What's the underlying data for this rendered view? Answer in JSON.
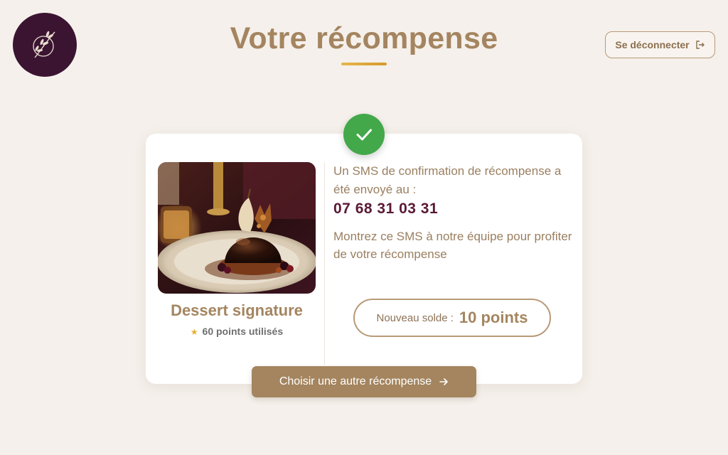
{
  "header": {
    "title": "Votre récompense",
    "logout_label": "Se déconnecter"
  },
  "reward": {
    "name": "Dessert signature",
    "points_used": "60 points utilisés"
  },
  "confirmation": {
    "sms_message": "Un SMS de confirmation de récompense a été envoyé au :",
    "phone_number": "07 68 31 03 31",
    "instruction": "Montrez ce SMS à notre équipe pour profiter de votre récompense"
  },
  "balance": {
    "label": "Nouveau solde :",
    "value": "10 points"
  },
  "actions": {
    "choose_other_label": "Choisir une autre récompense"
  },
  "icons": {
    "logo": "olive-branch-logo-icon",
    "logout": "logout-icon",
    "success": "checkmark-icon",
    "points": "star-icon",
    "cta_arrow": "arrow-right-icon"
  },
  "colors": {
    "background": "#f5f0eb",
    "brand_gold": "#a48560",
    "logo_plum": "#3b1432",
    "phone_text": "#5a1a35",
    "success_green": "#43a84a",
    "accent_underline": "#e6b64a"
  }
}
